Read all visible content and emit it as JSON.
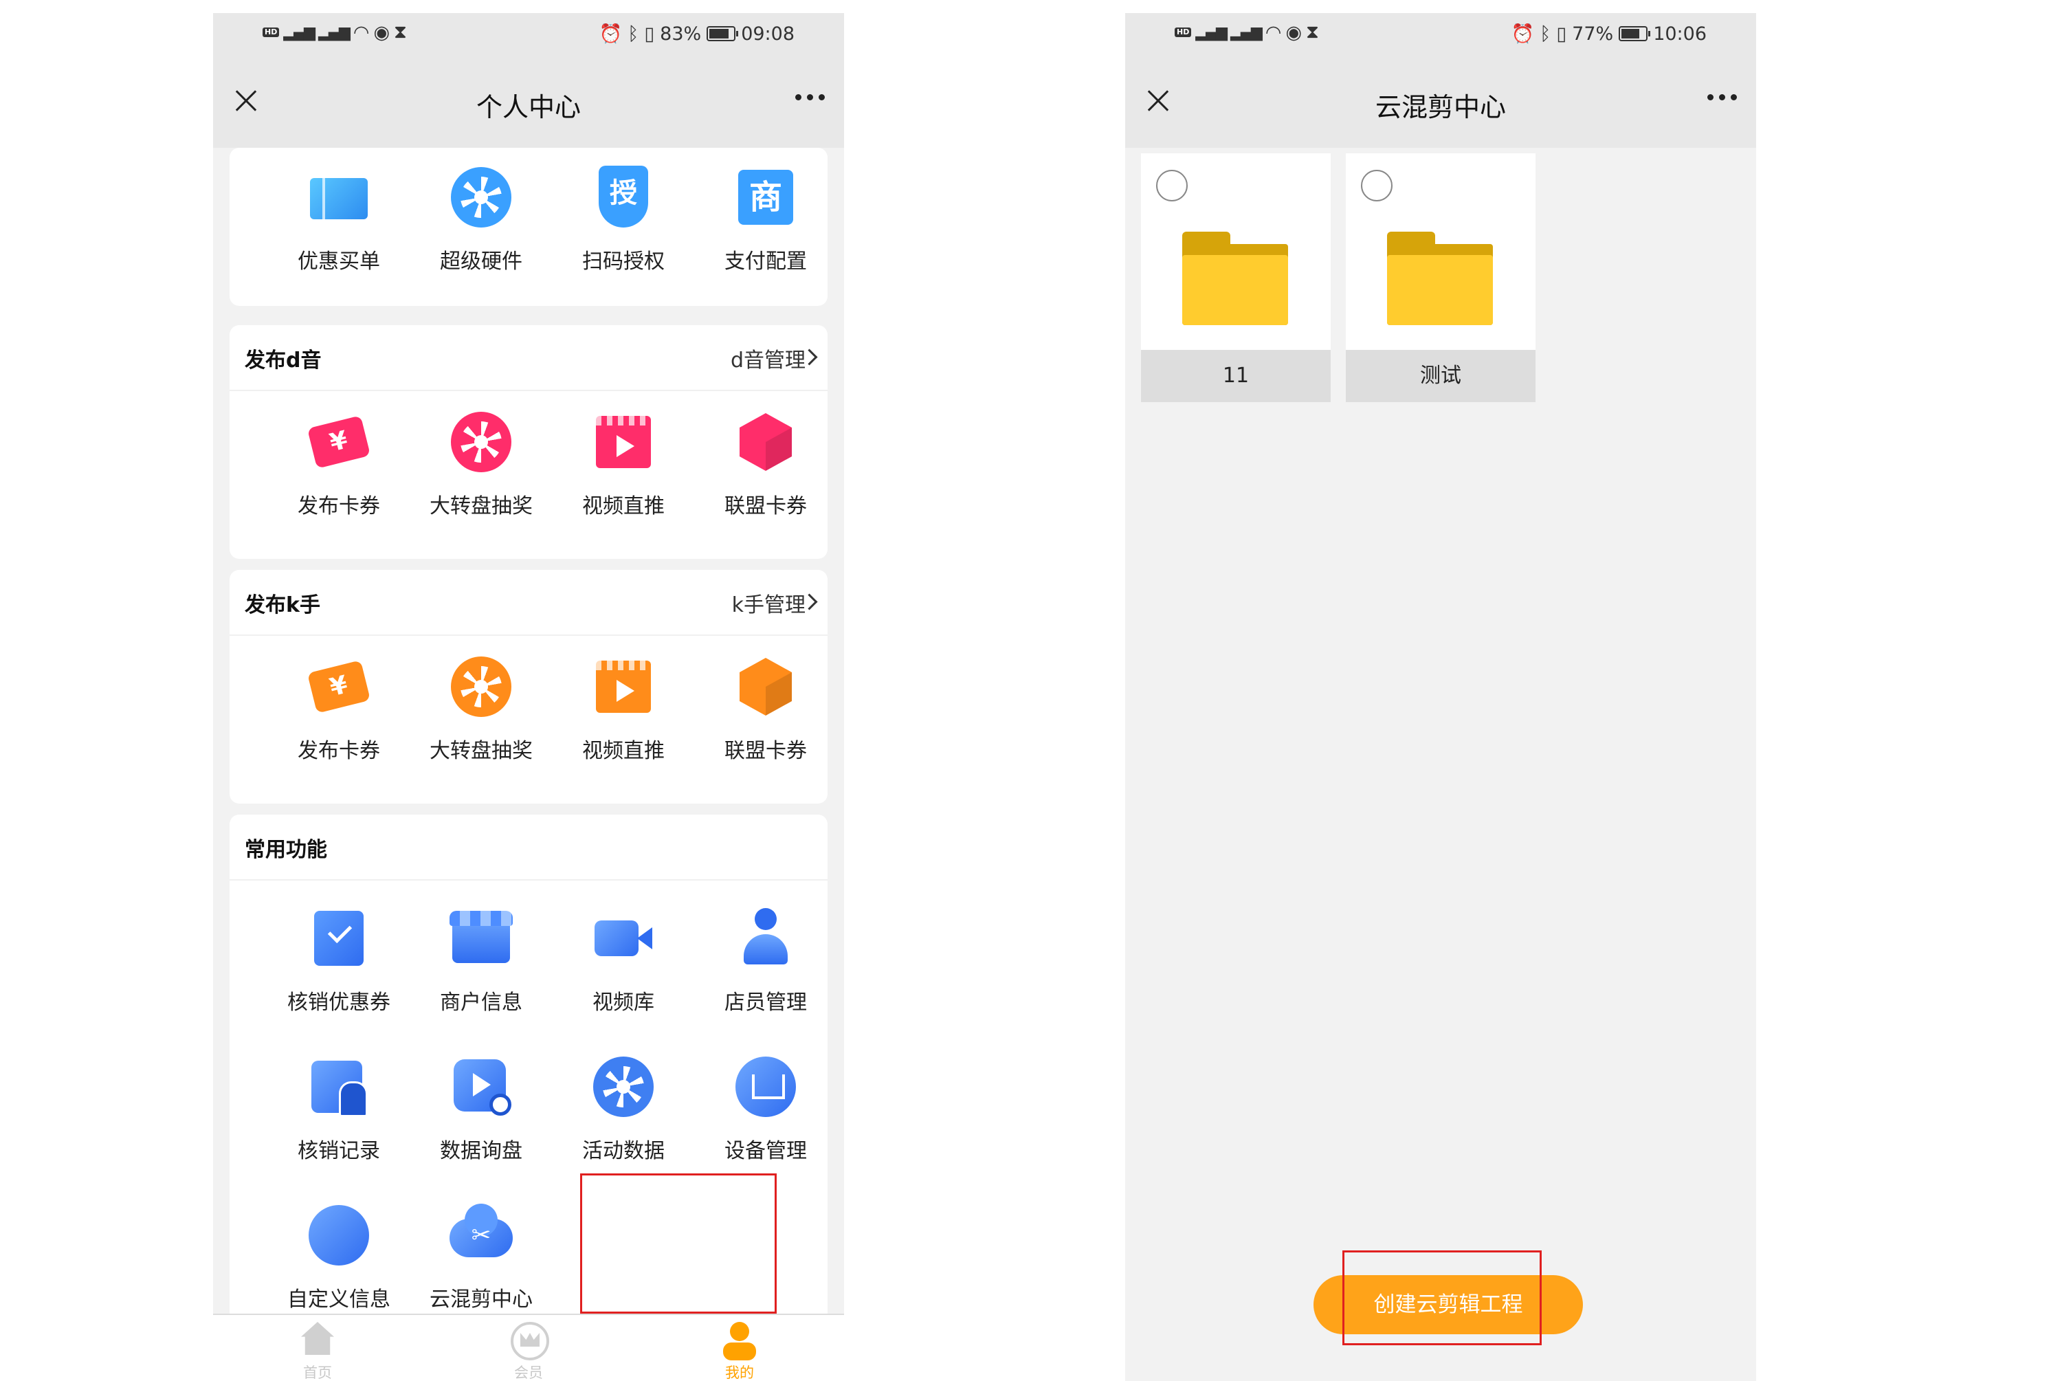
{
  "left_screen": {
    "status": {
      "battery": "83%",
      "time": "09:08",
      "battery_level": 0.83
    },
    "nav": {
      "title": "个人中心"
    },
    "top_card": {
      "items": [
        {
          "label": "优惠买单",
          "icon": "ticket-icon",
          "color": "#3aa0ff"
        },
        {
          "label": "超级硬件",
          "icon": "wheel-icon",
          "color": "#3aa0ff"
        },
        {
          "label": "扫码授权",
          "icon": "shield-icon",
          "glyph": "授",
          "color": "#3aa0ff"
        },
        {
          "label": "支付配置",
          "icon": "store-icon",
          "glyph": "商",
          "color": "#3aa0ff"
        }
      ]
    },
    "card_d": {
      "title": "发布d音",
      "more": "d音管理",
      "items": [
        {
          "label": "发布卡券",
          "icon": "coupon-icon",
          "glyph": "¥",
          "color": "#ff2d6a"
        },
        {
          "label": "大转盘抽奖",
          "icon": "wheel-icon",
          "color": "#ff2d6a"
        },
        {
          "label": "视频直推",
          "icon": "video-icon",
          "color": "#ff2d6a"
        },
        {
          "label": "联盟卡券",
          "icon": "cube-icon",
          "color": "#ff2d6a"
        }
      ]
    },
    "card_k": {
      "title": "发布k手",
      "more": "k手管理",
      "items": [
        {
          "label": "发布卡券",
          "icon": "coupon-icon",
          "glyph": "¥",
          "color": "#ff8c1a"
        },
        {
          "label": "大转盘抽奖",
          "icon": "wheel-icon",
          "color": "#ff8c1a"
        },
        {
          "label": "视频直推",
          "icon": "video-icon",
          "color": "#ff8c1a"
        },
        {
          "label": "联盟卡券",
          "icon": "cube-icon",
          "color": "#ff8c1a"
        }
      ]
    },
    "card_common": {
      "title": "常用功能",
      "items": [
        {
          "label": "核销优惠券",
          "icon": "check-receipt-icon"
        },
        {
          "label": "商户信息",
          "icon": "shop-icon"
        },
        {
          "label": "视频库",
          "icon": "camera-icon"
        },
        {
          "label": "店员管理",
          "icon": "staff-icon"
        },
        {
          "label": "核销记录",
          "icon": "record-icon"
        },
        {
          "label": "数据询盘",
          "icon": "play-search-icon"
        },
        {
          "label": "活动数据",
          "icon": "wheel-icon"
        },
        {
          "label": "设备管理",
          "icon": "device-home-icon"
        },
        {
          "label": "自定义信息",
          "icon": "custom-info-icon"
        },
        {
          "label": "云混剪中心",
          "icon": "cloud-scissors-icon",
          "glyph": "✂"
        }
      ]
    },
    "tabbar": [
      {
        "label": "首页",
        "icon": "home-icon"
      },
      {
        "label": "会员",
        "icon": "vip-crown-icon"
      },
      {
        "label": "我的",
        "icon": "me-icon"
      }
    ],
    "highlight_color": "#e02020"
  },
  "right_screen": {
    "status": {
      "battery": "77%",
      "time": "10:06",
      "battery_level": 0.77
    },
    "nav": {
      "title": "云混剪中心"
    },
    "folders": [
      {
        "name": "11",
        "icon": "folder-icon"
      },
      {
        "name": "测试",
        "icon": "folder-icon"
      }
    ],
    "create_button": "创建云剪辑工程",
    "accent_color": "#ffa319"
  }
}
